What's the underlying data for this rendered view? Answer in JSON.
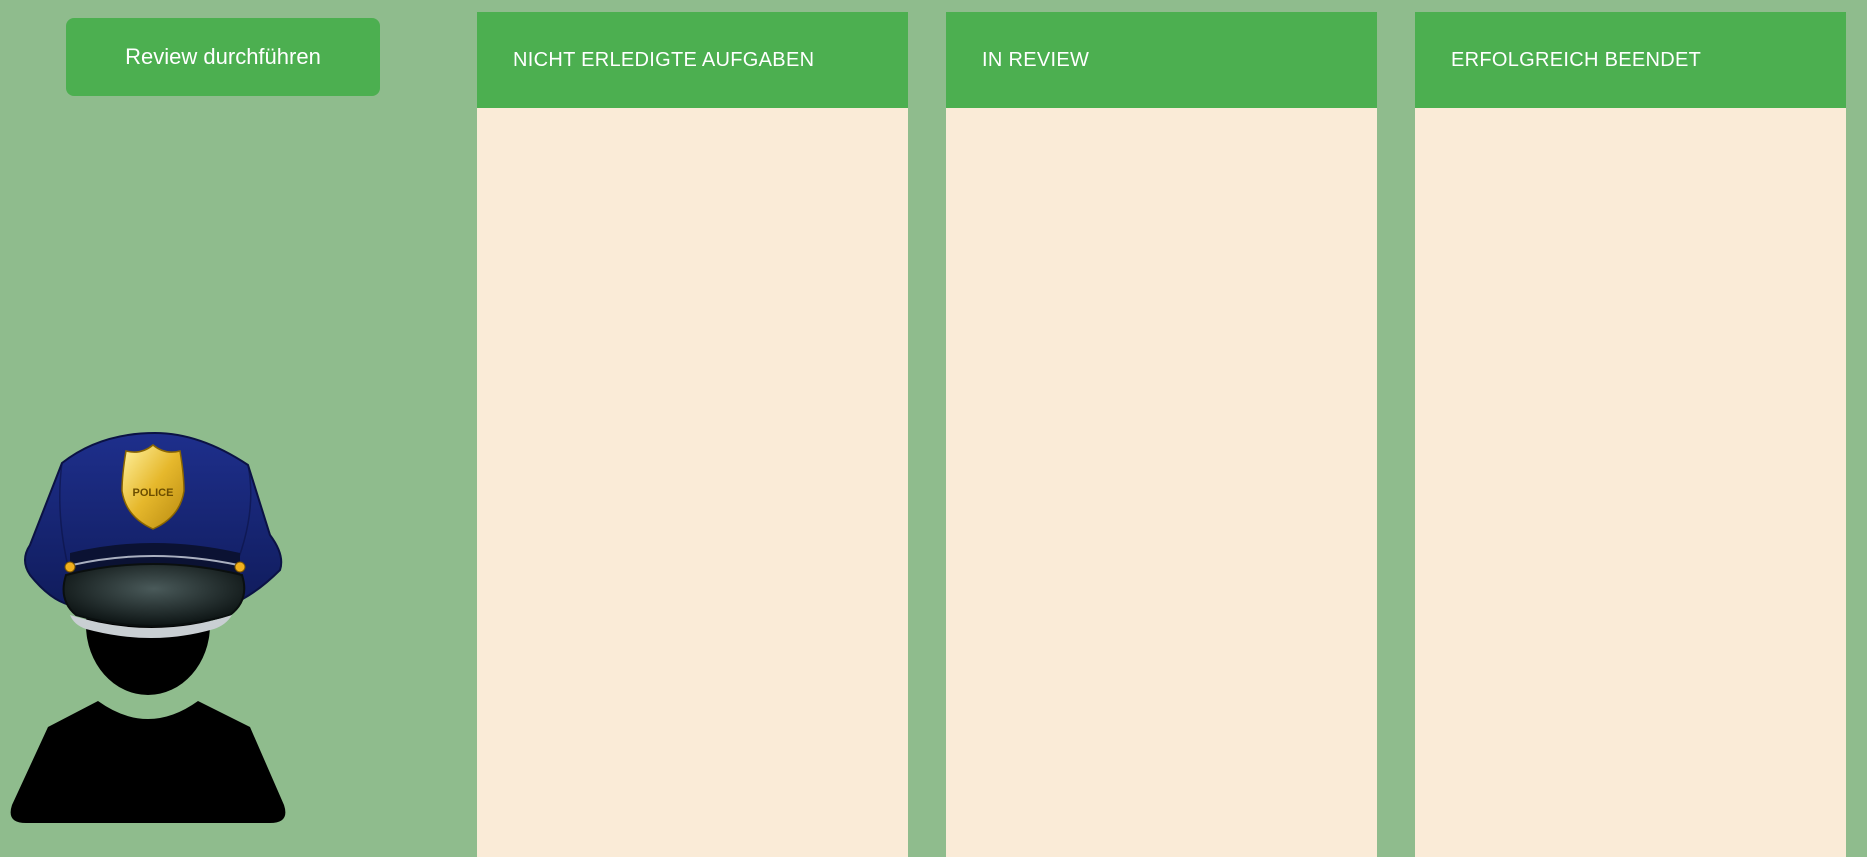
{
  "toolbar": {
    "review_label": "Review durchführen"
  },
  "avatar": {
    "badge_text": "POLICE"
  },
  "columns": [
    {
      "title": "NICHT ERLEDIGTE AUFGABEN"
    },
    {
      "title": "IN REVIEW"
    },
    {
      "title": "ERFOLGREICH BEENDET"
    }
  ],
  "colors": {
    "background": "#8fbc8d",
    "accent": "#4caf50",
    "column_body": "#faebd7",
    "cap_blue": "#1a2a80",
    "badge_gold": "#e0b32a"
  }
}
